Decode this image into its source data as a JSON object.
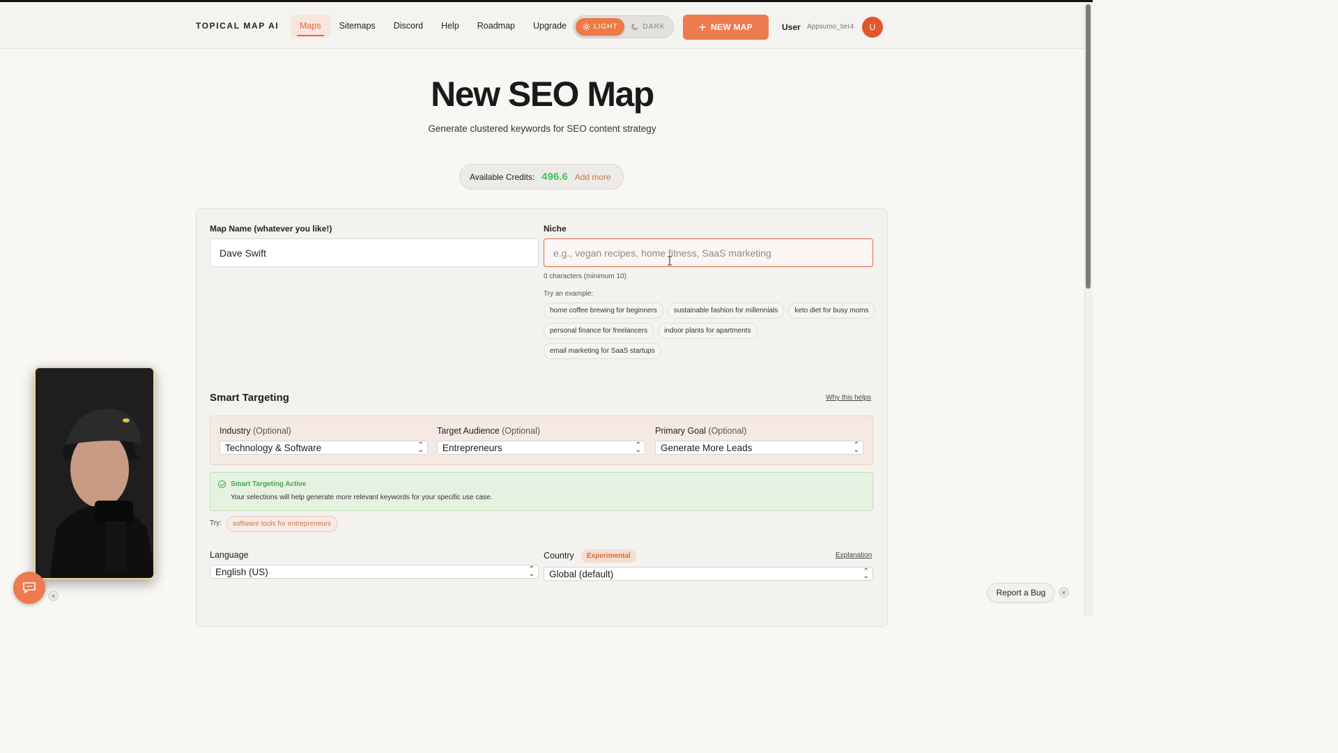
{
  "header": {
    "brand": "TOPICAL MAP AI",
    "nav": [
      "Maps",
      "Sitemaps",
      "Discord",
      "Help",
      "Roadmap",
      "Upgrade"
    ],
    "active_nav": "Maps",
    "theme": {
      "light": "LIGHT",
      "dark": "DARK",
      "selected": "LIGHT"
    },
    "new_map": "NEW MAP",
    "user_label": "User",
    "user_name": "Appsumo_tier4",
    "avatar_initial": "U"
  },
  "hero": {
    "title": "New SEO Map",
    "subtitle": "Generate clustered keywords for SEO content strategy"
  },
  "credits": {
    "label": "Available Credits:",
    "value": "496.6",
    "add_more": "Add more"
  },
  "form": {
    "map_name_label": "Map Name (whatever you like!)",
    "map_name_value": "Dave Swift",
    "niche_label": "Niche",
    "niche_placeholder": "e.g., vegan recipes, home fitness, SaaS marketing",
    "niche_value": "",
    "niche_counter": "0 characters (minimum 10)",
    "try_example_label": "Try an example:",
    "examples": [
      "home coffee brewing for beginners",
      "sustainable fashion for millennials",
      "keto diet for busy moms",
      "personal finance for freelancers",
      "indoor plants for apartments",
      "email marketing for SaaS startups"
    ]
  },
  "smart_targeting": {
    "title": "Smart Targeting",
    "why_link": "Why this helps",
    "optional_label": "(Optional)",
    "industry_label": "Industry",
    "industry_value": "Technology & Software",
    "audience_label": "Target Audience",
    "audience_value": "Entrepreneurs",
    "goal_label": "Primary Goal",
    "goal_value": "Generate More Leads",
    "active_title": "Smart Targeting Active",
    "active_desc": "Your selections will help generate more relevant keywords for your specific use case.",
    "try_label": "Try:",
    "try_suggestion": "software tools for entrepreneurs"
  },
  "locale": {
    "language_label": "Language",
    "language_value": "English (US)",
    "country_label": "Country",
    "country_badge": "Experimental",
    "explanation_link": "Explanation",
    "country_value": "Global (default)"
  },
  "footer": {
    "report_bug": "Report a Bug",
    "close_symbol": "×"
  },
  "colors": {
    "accent": "#ee7a4f",
    "credits_green": "#3ec55e",
    "success_green": "#3daa47"
  },
  "icons": [
    "sun-icon",
    "moon-icon",
    "plus-icon",
    "check-circle-icon",
    "chat-icon",
    "close-icon",
    "select-arrows-icon",
    "text-cursor-icon"
  ]
}
